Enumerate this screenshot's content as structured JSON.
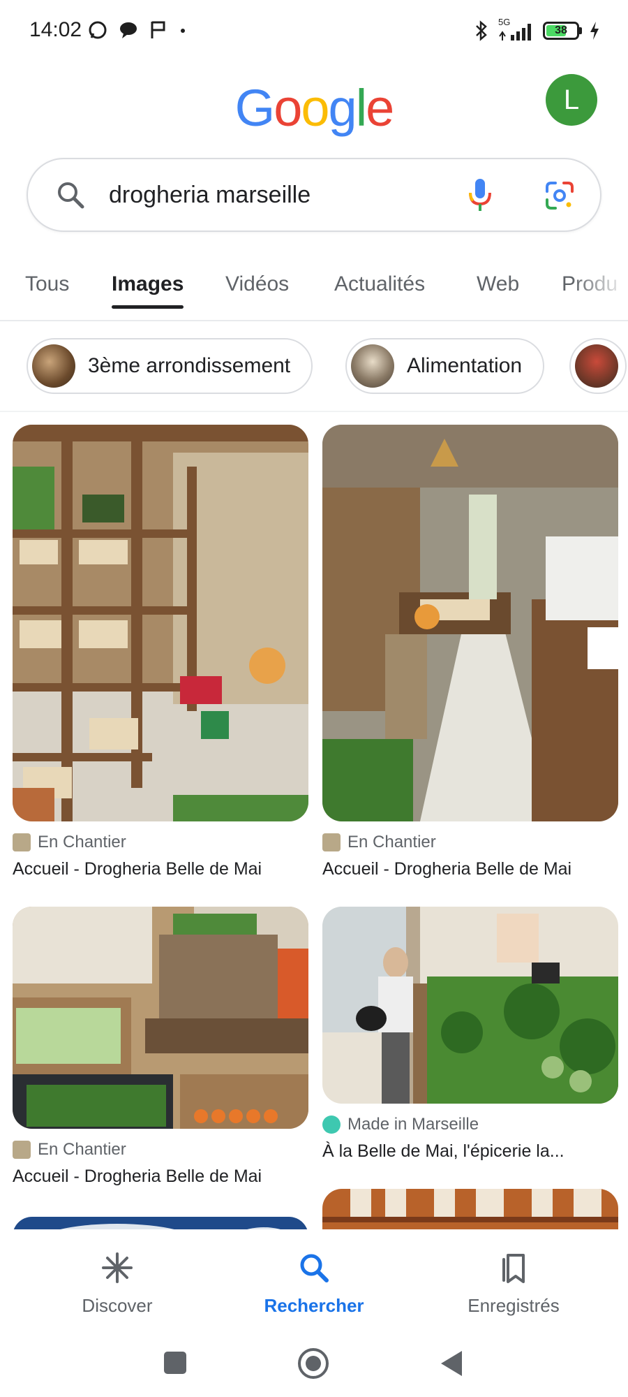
{
  "status_bar": {
    "time": "14:02",
    "network": "5G",
    "battery": "38"
  },
  "header": {
    "logo": [
      "G",
      "o",
      "o",
      "g",
      "l",
      "e"
    ],
    "logo_colors": [
      "#4285F4",
      "#EA4335",
      "#FBBC05",
      "#4285F4",
      "#34A853",
      "#EA4335"
    ],
    "avatar_initial": "L",
    "avatar_color": "#3c9a3c"
  },
  "search": {
    "query": "drogheria marseille"
  },
  "tabs": [
    {
      "label": "Tous",
      "active": false
    },
    {
      "label": "Images",
      "active": true
    },
    {
      "label": "Vidéos",
      "active": false
    },
    {
      "label": "Actualités",
      "active": false
    },
    {
      "label": "Web",
      "active": false
    },
    {
      "label": "Produ",
      "active": false
    }
  ],
  "chips": [
    {
      "label": "3ème arrondissement"
    },
    {
      "label": "Alimentation"
    },
    {
      "label": ""
    }
  ],
  "results": [
    {
      "source": "En Chantier",
      "title": "Accueil - Drogheria Belle de Mai"
    },
    {
      "source": "En Chantier",
      "title": "Accueil - Drogheria Belle de Mai"
    },
    {
      "source": "En Chantier",
      "title": "Accueil - Drogheria Belle de Mai"
    },
    {
      "source": "Made in Marseille",
      "title": "À la Belle de Mai, l'épicerie la..."
    }
  ],
  "bottom_nav": [
    {
      "label": "Discover",
      "icon": "asterisk-icon",
      "active": false
    },
    {
      "label": "Rechercher",
      "icon": "search-icon",
      "active": true
    },
    {
      "label": "Enregistrés",
      "icon": "bookmarks-icon",
      "active": false
    }
  ],
  "colors": {
    "accent": "#1a73e8",
    "text": "#202124",
    "muted": "#5f6368"
  }
}
